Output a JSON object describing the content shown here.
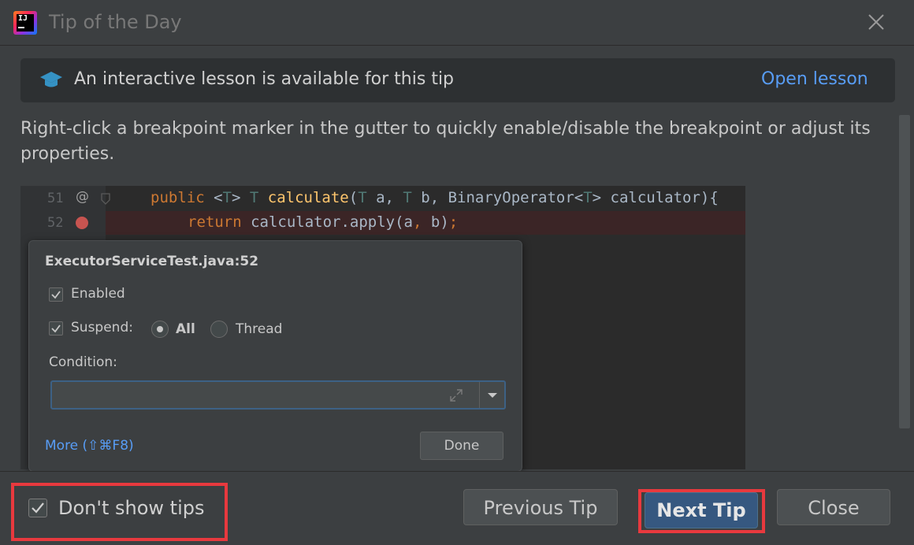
{
  "window": {
    "title": "Tip of the Day",
    "app_logo_text": "IJ"
  },
  "lesson": {
    "text": "An interactive lesson is available for this tip",
    "link": "Open lesson"
  },
  "tip": {
    "text": "Right-click a breakpoint marker in the gutter to quickly enable/disable the breakpoint or adjust its properties."
  },
  "code": {
    "line_numbers": [
      "51",
      "52"
    ],
    "line51": "public <T> T calculate(T a, T b, BinaryOperator<T> calculator){",
    "line52": "return calculator.apply(a, b);"
  },
  "popup": {
    "title": "ExecutorServiceTest.java:52",
    "enabled_label": "Enabled",
    "suspend_label": "Suspend:",
    "all_label": "All",
    "thread_label": "Thread",
    "condition_label": "Condition:",
    "condition_value": "",
    "more_link": "More (⇧⌘F8)",
    "done_label": "Done"
  },
  "footer": {
    "dont_show_label": "Don't show tips",
    "previous_label": "Previous Tip",
    "next_label": "Next Tip",
    "close_label": "Close"
  },
  "colors": {
    "accent_link": "#589df6",
    "primary_button": "#365880",
    "highlight_red": "#e8393e",
    "breakpoint_red": "#c75450"
  },
  "icons": [
    "app-logo",
    "close-icon",
    "graduation-cap-icon",
    "breakpoint-icon",
    "checkmark-icon",
    "expand-icon",
    "chevron-down-icon"
  ]
}
